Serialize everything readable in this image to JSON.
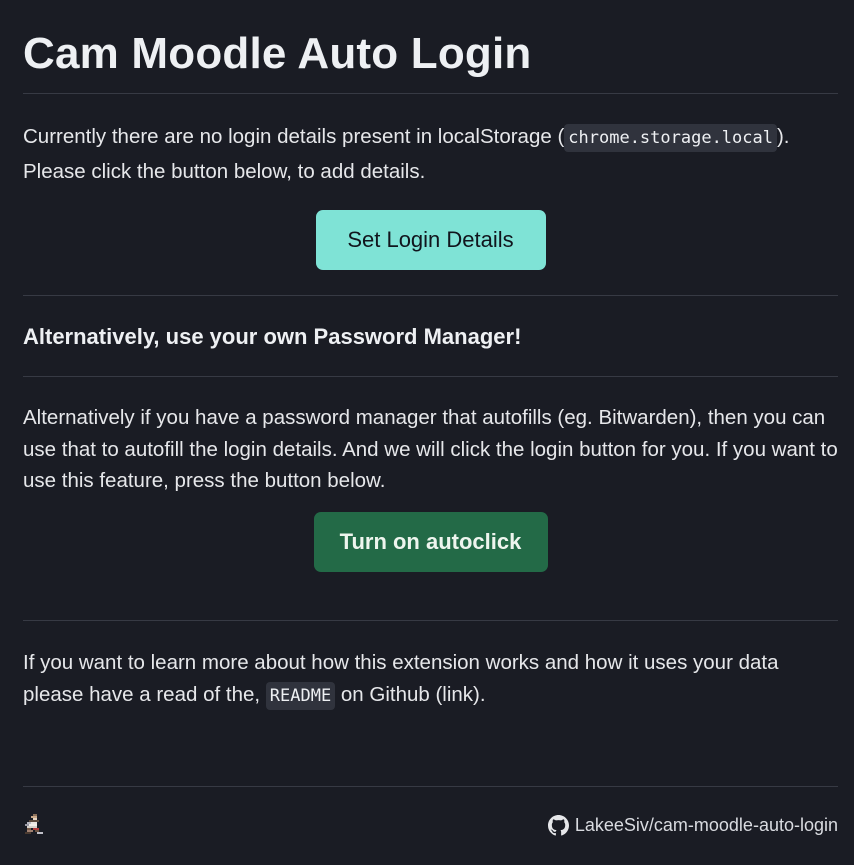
{
  "header": {
    "title": "Cam Moodle Auto Login"
  },
  "login_section": {
    "text_before_code": "Currently there are no login details present in localStorage (",
    "code": "chrome.storage.local",
    "text_after_code": ").",
    "text_line2": "Please click the button below, to add details.",
    "button_label": "Set Login Details",
    "button_color": "#7fe3d6"
  },
  "password_manager_section": {
    "heading": "Alternatively, use your own Password Manager!",
    "description": "Alternatively if you have a password manager that autofills (eg. Bitwarden), then you can use that to autofill the login details. And we will click the login button for you. If you want to use this feature, press the button below.",
    "button_label": "Turn on autoclick",
    "button_color": "#236a47"
  },
  "readme_section": {
    "text_before_code": "If you want to learn more about how this extension works and how it uses your data please have a read of the, ",
    "code": "README",
    "text_after_code": " on Github (link)."
  },
  "footer": {
    "avatar_icon": "pixel-avatar-icon",
    "github_icon": "github-icon",
    "repo_label": "LakeeSiv/cam-moodle-auto-login"
  },
  "colors": {
    "background": "#1a1c24",
    "text": "#e6e7ea",
    "divider": "#373a44",
    "code_background": "#30333d"
  }
}
